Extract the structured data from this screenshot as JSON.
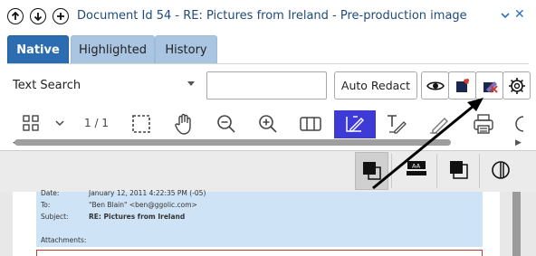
{
  "window": {
    "title": "Document Id 54 - RE: Pictures from Ireland - Pre-production image",
    "nav_icons": [
      "arrow-up-icon",
      "arrow-down-icon",
      "plus-icon"
    ],
    "close_icon": "close-icon"
  },
  "tabs": [
    {
      "label": "Native",
      "active": true
    },
    {
      "label": "Highlighted",
      "active": false
    },
    {
      "label": "History",
      "active": false
    }
  ],
  "search": {
    "mode_label": "Text Search",
    "input_value": "",
    "auto_redact_label": "Auto Redact",
    "action_icons": [
      "eye-icon",
      "redaction-mark-icon",
      "remove-redaction-icon",
      "settings-gear-icon"
    ]
  },
  "toolbar": {
    "page_indicator": "1 / 1",
    "tools": [
      "thumbnails-grid-icon",
      "chevron-down-icon",
      "select-region-icon",
      "pan-hand-icon",
      "zoom-out-icon",
      "zoom-in-icon",
      "two-page-view-icon",
      "redaction-draw-icon",
      "text-redaction-icon",
      "pen-icon",
      "print-icon"
    ],
    "active_tool": "redaction-draw-icon",
    "colors": {
      "active": "#3d3ad6",
      "tab_active": "#2c6db2",
      "tab_inactive": "#a9c5e2"
    }
  },
  "viewer_toolbar": {
    "modes": [
      "solid-redaction-icon",
      "text-label-redaction-icon",
      "outline-redaction-icon",
      "contrast-icon"
    ],
    "active_mode": "solid-redaction-icon"
  },
  "email": {
    "date_label": "Date:",
    "date_value": "January 12, 2011 4:22:35 PM (-05)",
    "to_label": "To:",
    "to_value": "\"Ben Blain\" <ben@ggolic.com>",
    "subject_label": "Subject:",
    "subject_value": "RE: Pictures from Ireland",
    "attachments_label": "Attachments:"
  }
}
